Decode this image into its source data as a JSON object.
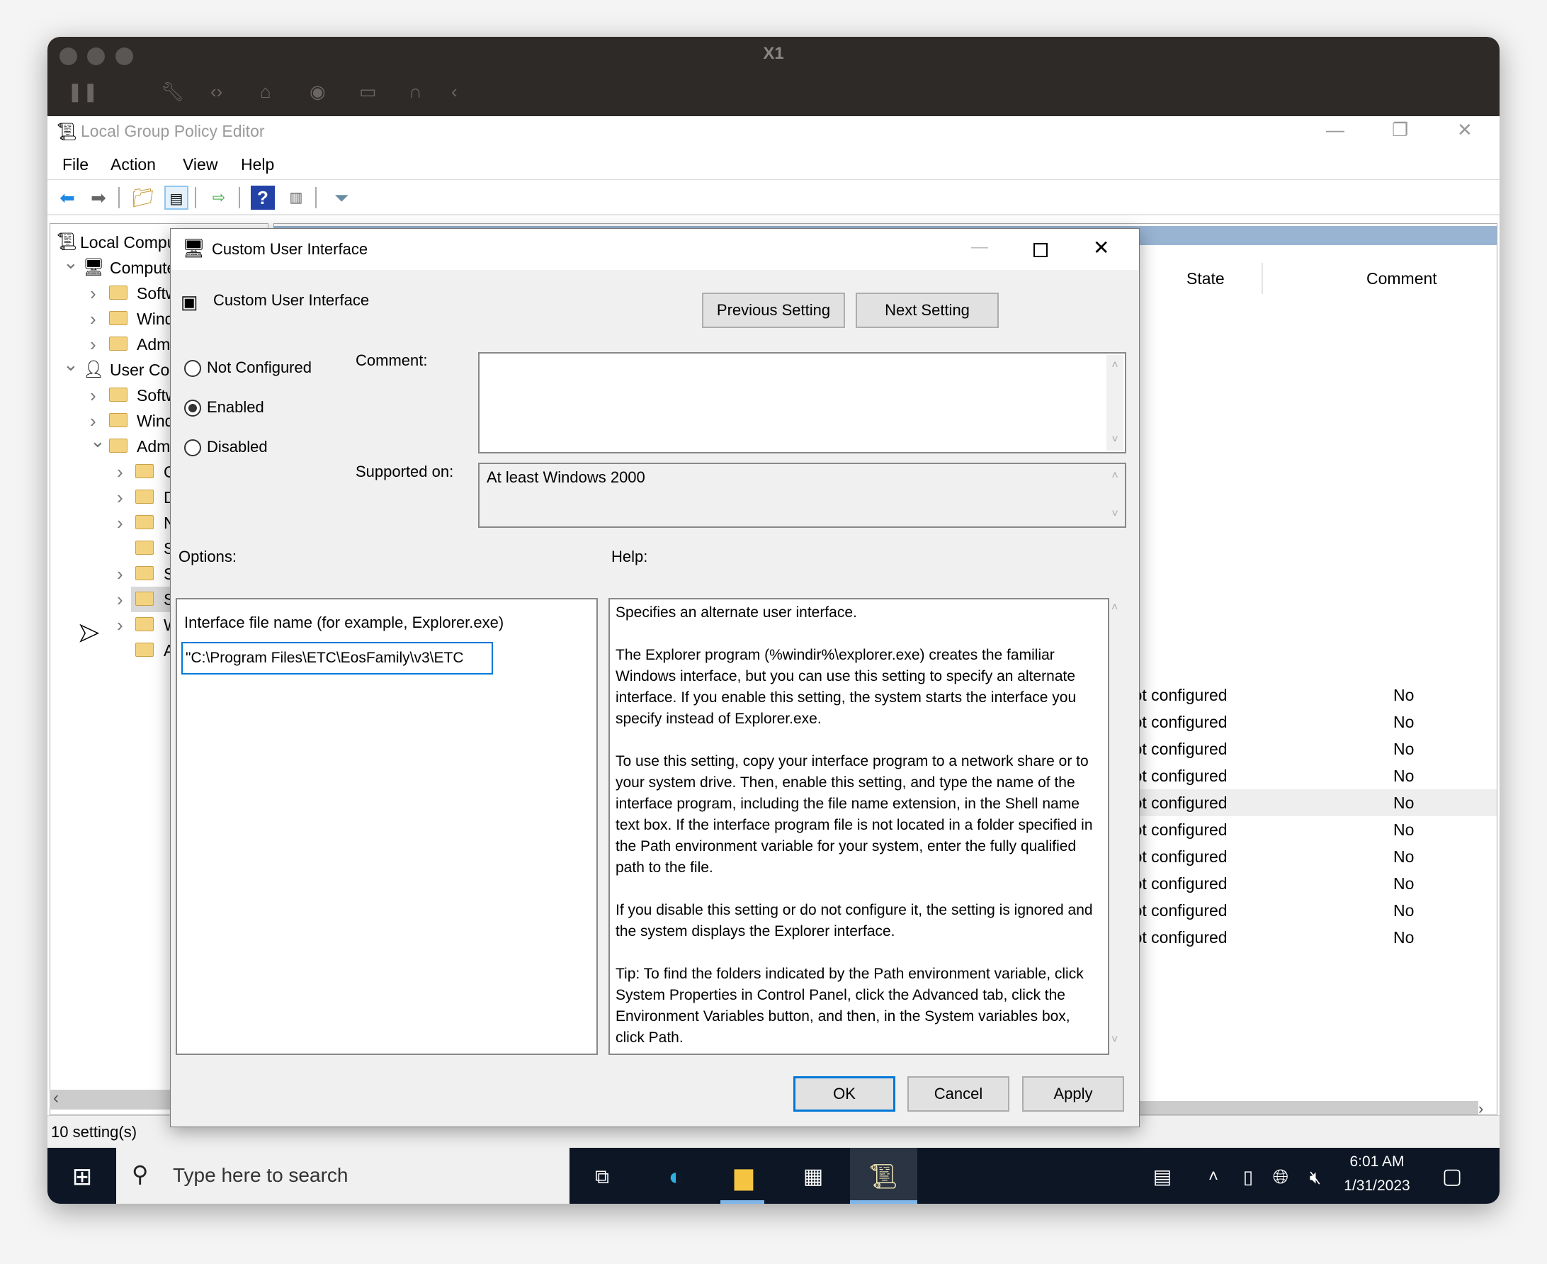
{
  "vm": {
    "title": "X1"
  },
  "app": {
    "title": "Local Group Policy Editor",
    "menu": [
      "File",
      "Action",
      "View",
      "Help"
    ]
  },
  "tree": [
    {
      "label": "Local Computer Policy",
      "level": 0,
      "chev": "",
      "icon": "policy"
    },
    {
      "label": "Computer Configuration",
      "level": 1,
      "chev": "down",
      "icon": "computer"
    },
    {
      "label": "Software Settings",
      "level": 2,
      "chev": "right",
      "icon": "folder"
    },
    {
      "label": "Windows Settings",
      "level": 2,
      "chev": "right",
      "icon": "folder"
    },
    {
      "label": "Administrative Templates",
      "level": 2,
      "chev": "right",
      "icon": "folder"
    },
    {
      "label": "User Configuration",
      "level": 1,
      "chev": "down",
      "icon": "user"
    },
    {
      "label": "Software Settings",
      "level": 2,
      "chev": "right",
      "icon": "folder"
    },
    {
      "label": "Windows Settings",
      "level": 2,
      "chev": "right",
      "icon": "folder"
    },
    {
      "label": "Administrative Templates",
      "level": 2,
      "chev": "down",
      "icon": "folder"
    },
    {
      "label": "Control Panel",
      "level": 3,
      "chev": "right",
      "icon": "folder"
    },
    {
      "label": "Desktop",
      "level": 3,
      "chev": "right",
      "icon": "folder"
    },
    {
      "label": "Network",
      "level": 3,
      "chev": "right",
      "icon": "folder"
    },
    {
      "label": "Shared Folders",
      "level": 3,
      "chev": "",
      "icon": "folder"
    },
    {
      "label": "Start Menu and Taskbar",
      "level": 3,
      "chev": "right",
      "icon": "folder"
    },
    {
      "label": "System",
      "level": 3,
      "chev": "right",
      "icon": "folder",
      "selected": true
    },
    {
      "label": "Windows Components",
      "level": 3,
      "chev": "right",
      "icon": "folder"
    },
    {
      "label": "All Settings",
      "level": 3,
      "chev": "",
      "icon": "all-settings"
    }
  ],
  "list": {
    "columns": {
      "state": "State",
      "comment": "Comment"
    },
    "rows": [
      {
        "state": "Not configured",
        "comment": "No"
      },
      {
        "state": "Not configured",
        "comment": "No"
      },
      {
        "state": "Not configured",
        "comment": "No"
      },
      {
        "state": "Not configured",
        "comment": "No"
      },
      {
        "state": "Not configured",
        "comment": "No",
        "highlight": true
      },
      {
        "state": "Not configured",
        "comment": "No"
      },
      {
        "state": "Not configured",
        "comment": "No"
      },
      {
        "state": "Not configured",
        "comment": "No"
      },
      {
        "state": "Not configured",
        "comment": "No"
      },
      {
        "state": "Not configured",
        "comment": "No"
      }
    ]
  },
  "status": {
    "text": "10 setting(s)"
  },
  "dialog": {
    "title": "Custom User Interface",
    "setting_name": "Custom User Interface",
    "prev": "Previous Setting",
    "next": "Next Setting",
    "radios": {
      "not_configured": "Not Configured",
      "enabled": "Enabled",
      "disabled": "Disabled",
      "selected": "enabled"
    },
    "comment_label": "Comment:",
    "comment_value": "",
    "supported_label": "Supported on:",
    "supported_value": "At least Windows 2000",
    "options_label": "Options:",
    "help_label": "Help:",
    "option_field_label": "Interface file name (for example, Explorer.exe)",
    "option_field_value": "\"C:\\Program Files\\ETC\\EosFamily\\v3\\ETC",
    "help": [
      "Specifies an alternate user interface.",
      "The Explorer program (%windir%\\explorer.exe) creates the familiar Windows interface, but you can use this setting to specify an alternate interface. If you enable this setting, the system starts the interface you specify instead of Explorer.exe.",
      "To use this setting, copy your interface program to a network share or to your system drive. Then, enable this setting, and type the name of the interface program, including the file name extension, in the Shell name text box. If the interface program file is not located in a folder specified in the Path environment variable for your system, enter the fully qualified path to the file.",
      "If you disable this setting or do not configure it, the setting is ignored and the system displays the Explorer interface.",
      "Tip: To find the folders indicated by the Path environment variable, click System Properties in Control Panel, click the Advanced tab, click the Environment Variables button, and then, in the System variables box, click Path."
    ],
    "ok": "OK",
    "cancel": "Cancel",
    "apply": "Apply"
  },
  "taskbar": {
    "search_placeholder": "Type here to search",
    "time": "6:01 AM",
    "date": "1/31/2023"
  },
  "colors": {
    "accent": "#0078d7",
    "taskbar": "#0c1624",
    "list_header_band": "#98b4d2"
  }
}
